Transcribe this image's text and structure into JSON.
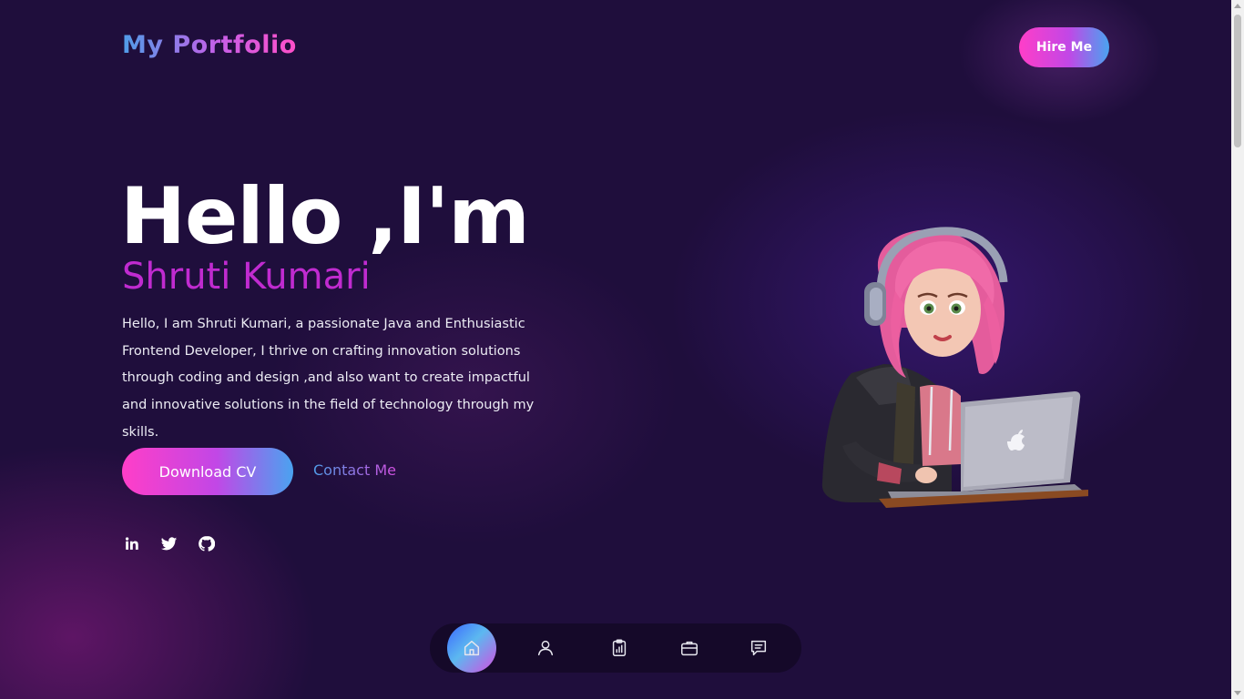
{
  "header": {
    "logo": "My Portfolio",
    "hire_button": "Hire Me"
  },
  "hero": {
    "greeting": "Hello ,I'm",
    "name": "Shruti Kumari",
    "description": "Hello, I am Shruti Kumari, a passionate Java and Enthusiastic Frontend Developer, I thrive on crafting innovation solutions through coding and design ,and also want to create impactful and innovative solutions in the field of technology through my skills.",
    "download_button": "Download CV",
    "contact_link": "Contact Me"
  },
  "socials": [
    {
      "icon": "linkedin-icon"
    },
    {
      "icon": "twitter-icon"
    },
    {
      "icon": "github-icon"
    }
  ],
  "bottom_nav": {
    "items": [
      {
        "icon": "home-icon",
        "active": true
      },
      {
        "icon": "user-icon",
        "active": false
      },
      {
        "icon": "clipboard-chart-icon",
        "active": false
      },
      {
        "icon": "briefcase-icon",
        "active": false
      },
      {
        "icon": "chat-icon",
        "active": false
      }
    ]
  },
  "colors": {
    "background": "#1f0e3c",
    "accent_pink": "#ff3ec8",
    "accent_blue": "#4aa3f0",
    "name_color": "#c02bd0"
  }
}
